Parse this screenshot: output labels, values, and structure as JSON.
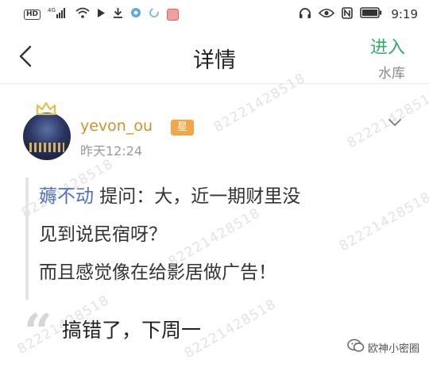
{
  "status_bar": {
    "hd_label": "HD",
    "network_label": "4G",
    "time": "9:19"
  },
  "nav": {
    "title": "详情",
    "enter_label": "进入",
    "enter_sub": "水库"
  },
  "watermark_text": "82221428518",
  "post": {
    "username": "yevon_ou",
    "badge": "星",
    "time": "昨天12:24"
  },
  "question": {
    "asker": "薅不动",
    "line1": " 提问：大，近一期财里没",
    "line2": "见到说民宿呀？",
    "line3": "而且感觉像在给影居做广告！"
  },
  "answer": {
    "text": "搞错了，下周一"
  },
  "brand": {
    "text": "欧神小密圈"
  },
  "colors": {
    "accent_green": "#3aa86b",
    "username_gold": "#c9932f",
    "asker_blue": "#4f6fb8",
    "badge_orange": "#f1a748"
  }
}
